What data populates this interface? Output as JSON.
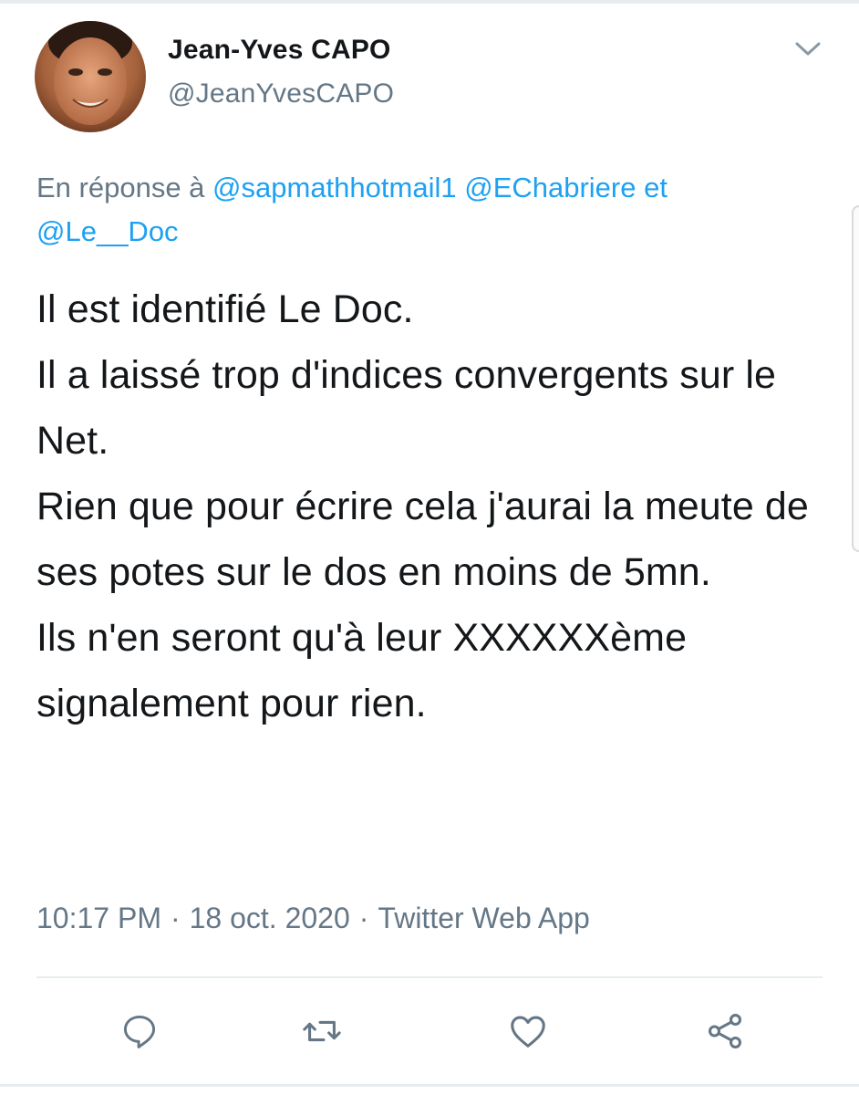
{
  "author": {
    "display_name": "Jean-Yves CAPO",
    "handle": "@JeanYvesCAPO",
    "avatar_icon": "profile-photo"
  },
  "reply": {
    "prefix": "En réponse à",
    "mention_1": "@sapmathhotmail1",
    "mention_2": "@EChabriere",
    "conjunction": "et",
    "mention_3": "@Le__Doc"
  },
  "tweet": {
    "text": "Il est identifié Le Doc.\nIl a laissé trop d'indices convergents sur le Net.\nRien que pour écrire cela j'aurai la meute de ses potes sur le dos en moins de 5mn.\nIls n'en seront qu'à leur XXXXXXème signalement pour rien."
  },
  "meta": {
    "time": "10:17 PM",
    "separator": "·",
    "date": "18 oct. 2020",
    "source": "Twitter Web App"
  },
  "actions": {
    "reply_icon": "reply-icon",
    "retweet_icon": "retweet-icon",
    "like_icon": "heart-icon",
    "share_icon": "share-icon"
  },
  "colors": {
    "text": "#14171a",
    "secondary": "#657786",
    "link": "#1da1f2",
    "divider": "#e6ecf0"
  }
}
